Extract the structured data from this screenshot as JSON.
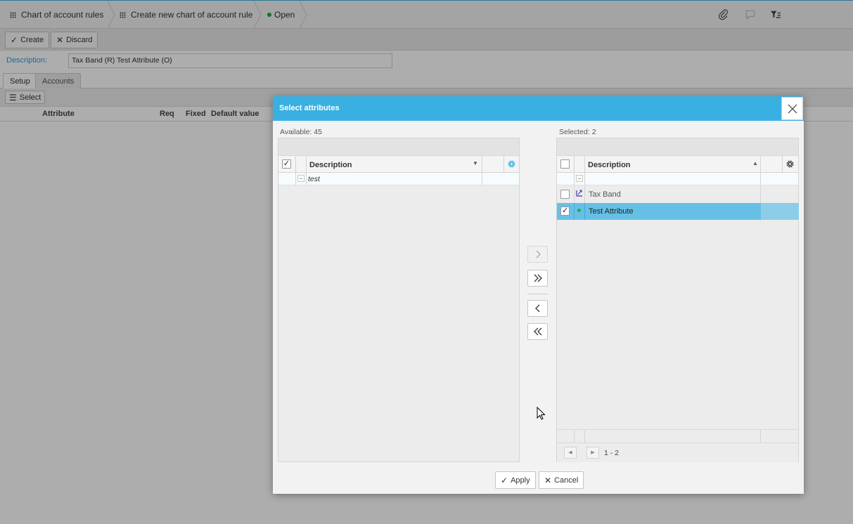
{
  "breadcrumbs": [
    {
      "label": "Chart of account rules"
    },
    {
      "label": "Create new chart of account rule"
    },
    {
      "label": "Open"
    }
  ],
  "toolbar": {
    "create_label": "Create",
    "discard_label": "Discard"
  },
  "form": {
    "description_label": "Description:",
    "description_value": "Tax Band (R) Test Attribute (O)"
  },
  "tabs": [
    {
      "label": "Setup"
    },
    {
      "label": "Accounts"
    }
  ],
  "subbar": {
    "select_label": "Select"
  },
  "columns": [
    "Attribute",
    "Req",
    "Fixed",
    "Default value"
  ],
  "modal": {
    "title": "Select attributes",
    "available_label": "Available: 45",
    "selected_label": "Selected: 2",
    "left_grid": {
      "header": "Description",
      "filter_value": "test",
      "sort_indicator": "▼"
    },
    "right_grid": {
      "header": "Description",
      "sort_indicator": "▲",
      "rows": [
        {
          "label": "Tax Band",
          "icon": "required-icon",
          "checked": false
        },
        {
          "label": "Test Attribute",
          "icon": "green-dot-icon",
          "checked": true
        }
      ],
      "pager_text": "1 - 2"
    },
    "apply_label": "Apply",
    "cancel_label": "Cancel"
  },
  "colors": {
    "accent": "#3ab0e2",
    "selected_row": "#66c0e6",
    "status_green": "#2aa845"
  }
}
